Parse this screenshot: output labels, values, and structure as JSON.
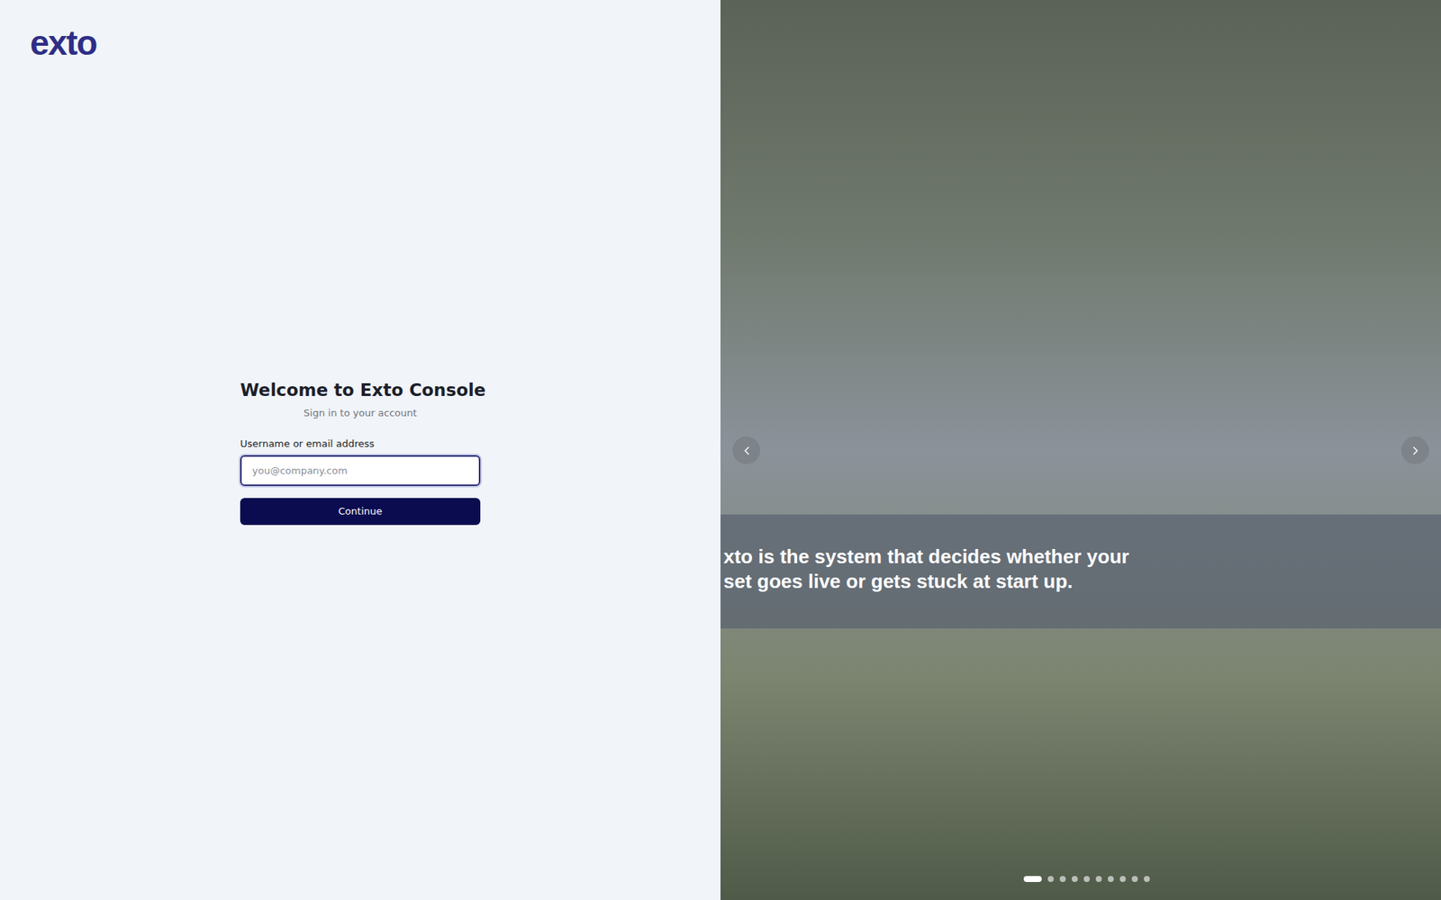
{
  "logo": "exto",
  "title": "Welcome to Exto Console",
  "subtitle": "Sign in to your account",
  "field": {
    "label": "Username or email address",
    "placeholder": "you@company.com",
    "focused": true
  },
  "button": "Continue",
  "carousel": {
    "caption": [
      "xto is the system that decides whether your",
      "set goes live or gets stuck at start up."
    ],
    "slides": [
      {
        "selected": true
      },
      {
        "selected": false
      },
      {
        "selected": false
      },
      {
        "selected": false
      },
      {
        "selected": false
      },
      {
        "selected": false
      },
      {
        "selected": false
      },
      {
        "selected": false
      },
      {
        "selected": false
      },
      {
        "selected": false
      }
    ]
  }
}
